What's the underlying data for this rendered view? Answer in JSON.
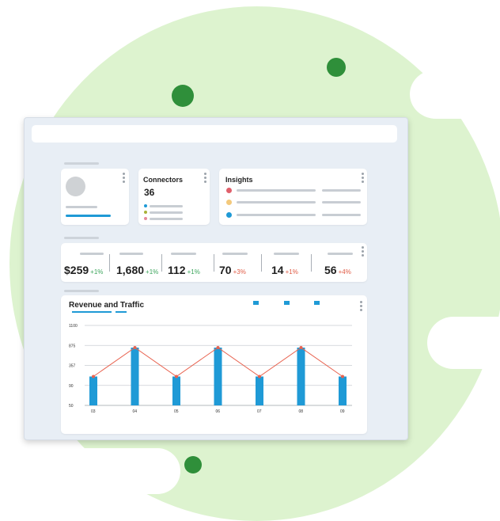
{
  "colors": {
    "background_blob": "#ddf3cf",
    "accent_green_dot": "#2f8f3a",
    "primary_blue": "#1f9ad6",
    "line_red": "#e8624f",
    "positive_green": "#3ca55c",
    "negative_red": "#e05a44",
    "insight_dot_red": "#e0606b",
    "insight_dot_yellow": "#f3c97c",
    "insight_dot_blue": "#1f9ad6",
    "connector_dot_blue": "#1f9ad6",
    "connector_dot_olive": "#a8b238",
    "connector_dot_pink": "#e58a9b"
  },
  "connectors": {
    "title": "Connectors",
    "count": "36"
  },
  "insights": {
    "title": "Insights"
  },
  "metrics": [
    {
      "value": "$259",
      "change": "+1%",
      "trend": "up"
    },
    {
      "value": "1,680",
      "change": "+1%",
      "trend": "up"
    },
    {
      "value": "112",
      "change": "+1%",
      "trend": "up"
    },
    {
      "value": "70",
      "change": "+3%",
      "trend": "down"
    },
    {
      "value": "14",
      "change": "+1%",
      "trend": "down"
    },
    {
      "value": "56",
      "change": "+4%",
      "trend": "down"
    }
  ],
  "chart_data": {
    "type": "bar",
    "title": "Revenue and Traffic",
    "categories": [
      "03",
      "04",
      "05",
      "06",
      "07",
      "08",
      "09"
    ],
    "y_ticks": [
      "1100",
      "875",
      "357",
      "90",
      "50"
    ],
    "series": [
      {
        "values": [
          2,
          4,
          2,
          4,
          2,
          4,
          2
        ],
        "kind": "bar",
        "color": "#1f9ad6"
      },
      {
        "values": [
          2,
          4,
          2,
          4,
          2,
          4,
          2
        ],
        "kind": "line",
        "color": "#e8624f"
      }
    ],
    "legend_placement": "top-right",
    "grid": true
  }
}
